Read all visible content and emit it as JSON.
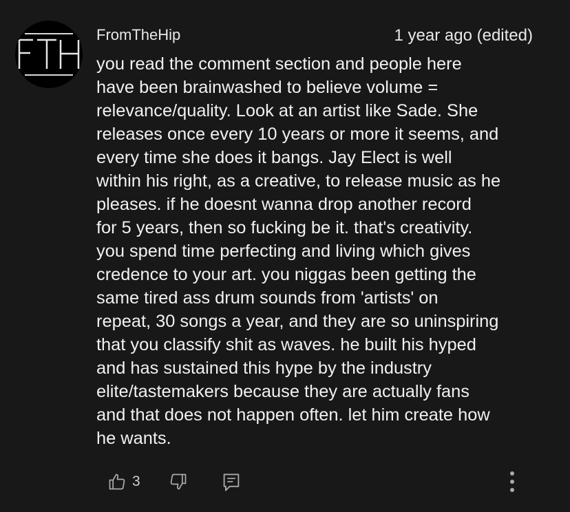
{
  "avatar": {
    "initials": "FTH"
  },
  "comment": {
    "author": "FromTheHip",
    "timestamp": "1 year ago (edited)",
    "body_lines": [
      "you read the comment section and people here",
      "have been brainwashed to believe volume =",
      "relevance/quality.  Look at an artist like Sade.  She",
      "releases once every 10 years or more it seems, and",
      "every time she does it bangs.  Jay Elect is well",
      "within his right, as a creative, to release music as he",
      "pleases.  if he doesnt wanna drop another record",
      "for 5 years, then so fucking be it.  that's creativity.",
      "you spend time perfecting and living which gives",
      "credence to your art.  you niggas been getting the",
      "same tired ass drum sounds from 'artists' on",
      "repeat, 30 songs a year, and they are so uninspiring",
      "that you classify shit as waves.  he built his hyped",
      "and has sustained this hype by the industry",
      "elite/tastemakers because they are actually fans",
      "and that does not happen often.  let him create how",
      "he wants."
    ]
  },
  "actions": {
    "like_count": "3",
    "like_icon": "thumbs-up-icon",
    "dislike_icon": "thumbs-down-icon",
    "reply_icon": "reply-icon",
    "more_icon": "more-vertical-icon"
  },
  "colors": {
    "background": "#181818",
    "text": "#f1f1f1",
    "icon": "#aaaaaa"
  }
}
